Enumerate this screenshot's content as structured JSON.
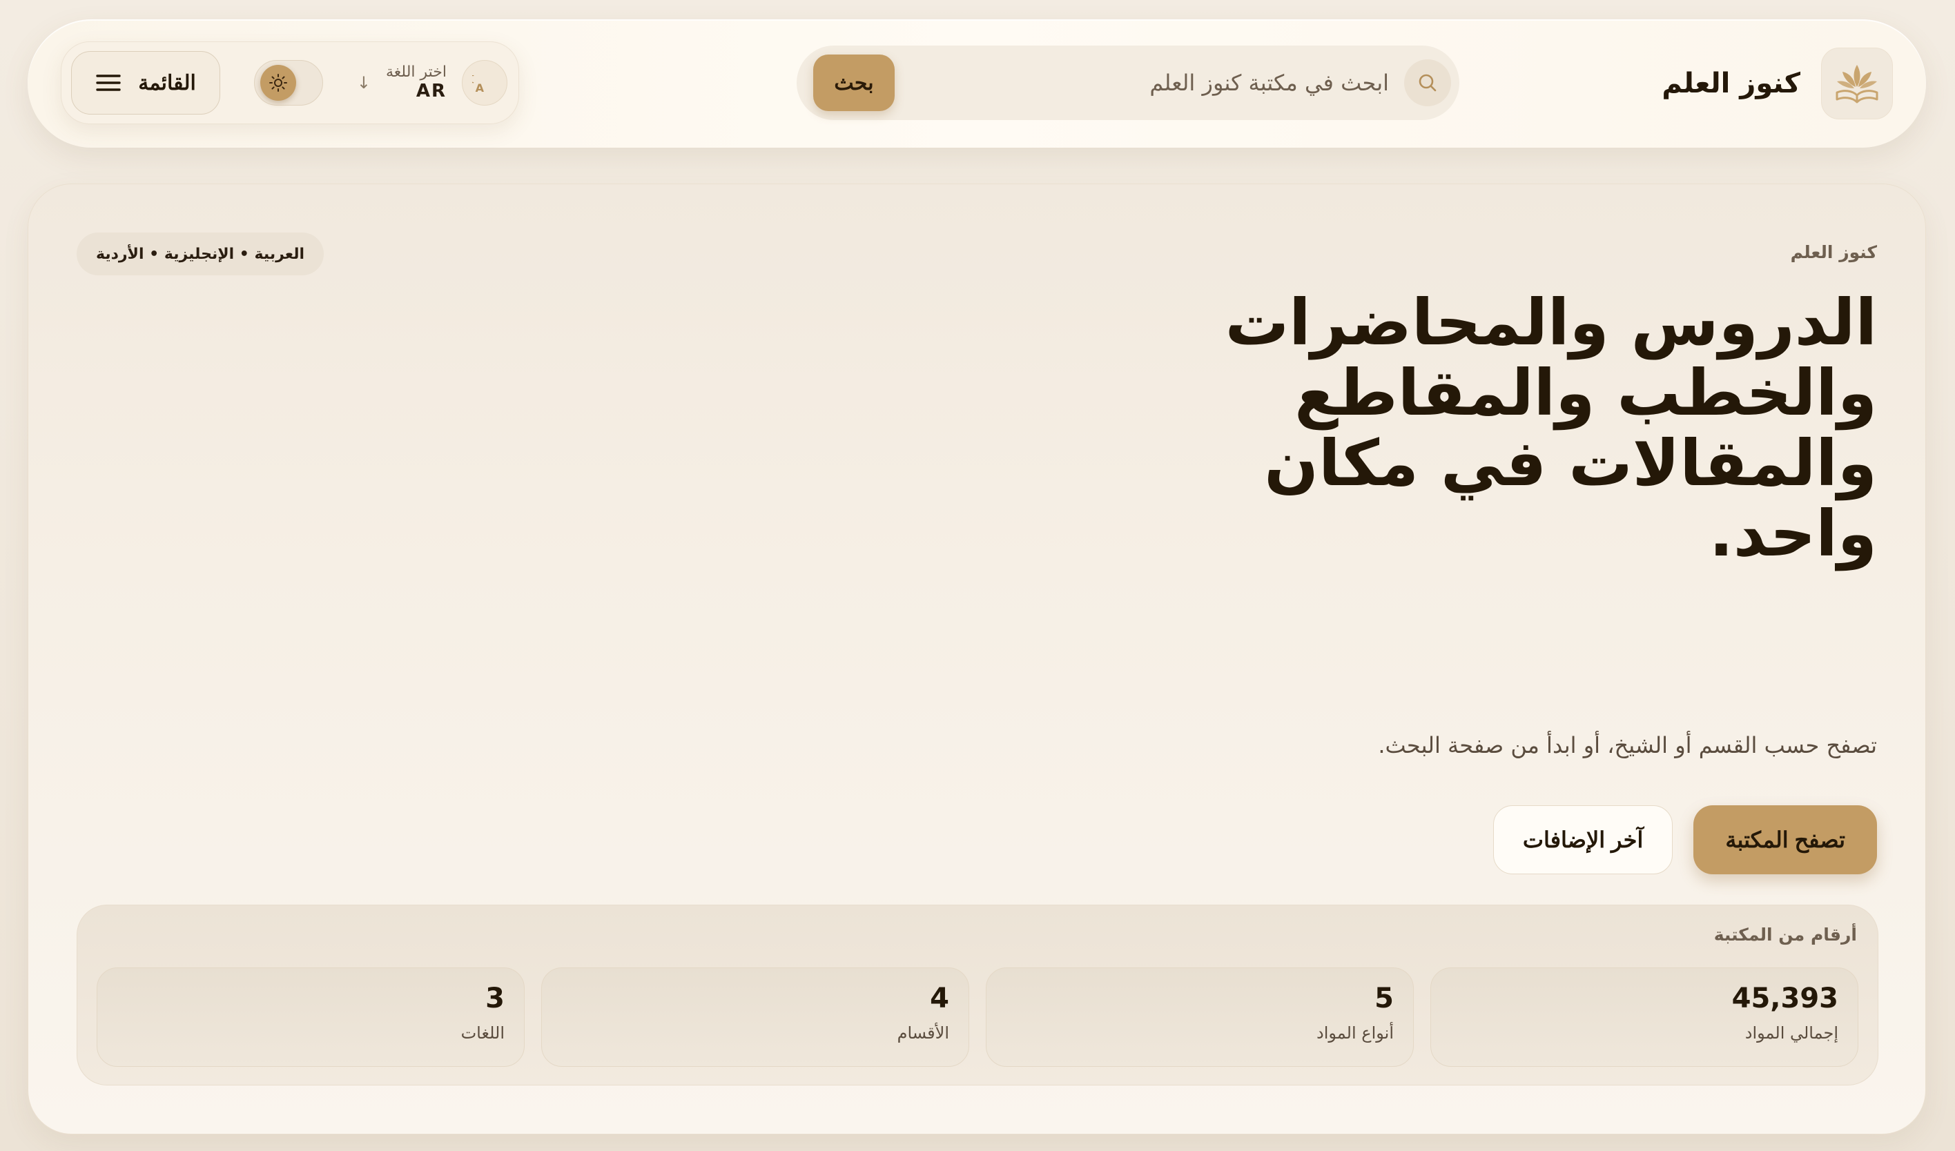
{
  "header": {
    "brand_name": "كنوز العلم",
    "search_placeholder": "ابحث في مكتبة كنوز العلم",
    "search_button": "بحث",
    "language_caption": "اختر اللغة",
    "language_code": "AR",
    "menu_label": "القائمة"
  },
  "hero": {
    "eyebrow": "كنوز العلم",
    "languages_pill": "العربية • الإنجليزية • الأردية",
    "headline": "الدروس والمحاضرات والخطب والمقاطع والمقالات في مكان واحد.",
    "subtitle": "تصفح حسب القسم أو الشيخ، أو ابدأ من صفحة البحث.",
    "primary_button": "تصفح المكتبة",
    "secondary_button": "آخر الإضافات"
  },
  "stats": {
    "title": "أرقام من المكتبة",
    "items": [
      {
        "value": "45,393",
        "label": "إجمالي المواد"
      },
      {
        "value": "5",
        "label": "أنواع المواد"
      },
      {
        "value": "4",
        "label": "الأقسام"
      },
      {
        "value": "3",
        "label": "اللغات"
      }
    ]
  },
  "colors": {
    "accent": "#c39c64",
    "text_dark": "#241808",
    "background": "#efe7dc"
  },
  "icons": [
    "book-plant-logo-icon",
    "search-icon",
    "translate-icon",
    "arrow-down-icon",
    "sun-icon",
    "menu-icon"
  ]
}
